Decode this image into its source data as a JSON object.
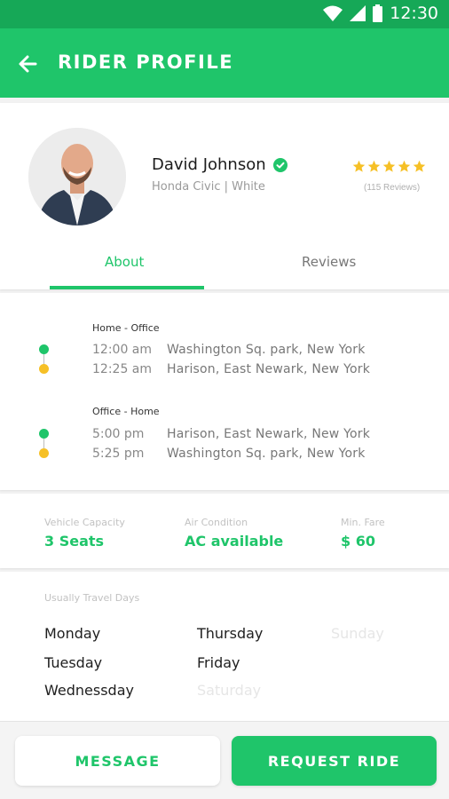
{
  "status_bar": {
    "time": "12:30",
    "icons": [
      "wifi-icon",
      "signal-icon",
      "battery-icon"
    ]
  },
  "header": {
    "title": "RIDER PROFILE",
    "back_icon": "arrow-left-icon"
  },
  "profile": {
    "name": "David Johnson",
    "verified_icon": "check-circle-icon",
    "vehicle": "Honda Civic |  White",
    "rating": 5,
    "reviews_count": "(115 Reviews)"
  },
  "tabs": [
    {
      "label": "About",
      "active": true
    },
    {
      "label": "Reviews",
      "active": false
    }
  ],
  "routes": [
    {
      "title": "Home - Office",
      "stops": [
        {
          "time": "12:00 am",
          "address": "Washington Sq. park, New York"
        },
        {
          "time": "12:25 am",
          "address": "Harison, East Newark, New York"
        }
      ]
    },
    {
      "title": "Office - Home",
      "stops": [
        {
          "time": "5:00 pm",
          "address": "Harison, East Newark, New York"
        },
        {
          "time": "5:25 pm",
          "address": "Washington Sq. park, New York"
        }
      ]
    }
  ],
  "info": [
    {
      "label": "Vehicle Capacity",
      "value": "3 Seats"
    },
    {
      "label": "Air Condition",
      "value": "AC available"
    },
    {
      "label": "Min. Fare",
      "value": "$ 60"
    }
  ],
  "travel_days": {
    "label": "Usually Travel Days",
    "days": [
      {
        "name": "Monday",
        "active": true
      },
      {
        "name": "Tuesday",
        "active": true
      },
      {
        "name": "Wednessday",
        "active": true
      },
      {
        "name": "Thursday",
        "active": true
      },
      {
        "name": "Friday",
        "active": true
      },
      {
        "name": "Saturday",
        "active": false
      },
      {
        "name": "Sunday",
        "active": false
      }
    ]
  },
  "actions": {
    "message": "MESSAGE",
    "request_ride": "REQUEST RIDE"
  },
  "colors": {
    "primary": "#1fc56a",
    "status_bar": "#16a857",
    "star": "#f6c026",
    "route_end": "#f6c026"
  }
}
